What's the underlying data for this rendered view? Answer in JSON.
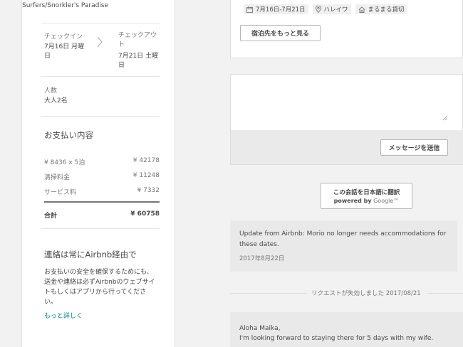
{
  "listing": {
    "name_line1": "Surfers/Snorkler's Paradise"
  },
  "booking": {
    "checkin_label": "チェックイン",
    "checkin_date_line1": "7月16日 月曜",
    "checkin_date_line2": "日",
    "checkout_label": "チェックアウ",
    "checkout_label2": "ト",
    "checkout_date_line1": "7月21日 土曜",
    "checkout_date_line2": "日",
    "guests_label": "人数",
    "guests_value": "大人2名"
  },
  "payment": {
    "title": "お支払い内容",
    "rows": [
      {
        "label": "¥ 8436 x 5泊",
        "amount": "¥ 42178"
      },
      {
        "label": "清掃料金",
        "amount": "¥ 11248"
      },
      {
        "label": "サービス料",
        "amount": "¥ 7332"
      }
    ],
    "total_label": "合計",
    "total_amount": "¥ 60758"
  },
  "notice": {
    "title": "連絡は常にAirbnb経由で",
    "line1": "お支払いの安全を確保するためにも、",
    "line2": "送金や連絡は必ずAirbnbのウェブサイ",
    "line3": "トもしくはアプリから行ってくださ",
    "line4": "い。",
    "more_link": "もっと詳しく"
  },
  "reservation": {
    "dates": "7月16日-7月21日",
    "location": "ハレイワ",
    "type": "まるまる貸切",
    "more_stays_button": "宿泊先をもっと見る"
  },
  "composer": {
    "send_button": "メッセージを送信"
  },
  "translate": {
    "button_label": "この会話を日本語に翻訳",
    "powered_by": "powered by",
    "google": "Google™"
  },
  "system_message": {
    "text": "Update from Airbnb: Morio no longer needs accommodations for these dates.",
    "date": "2017年8月22日"
  },
  "divider": {
    "text": "リクエストが失効しました 2017/08/21"
  },
  "guest_message": {
    "line1": "Aloha Maika,",
    "line2": "I'm looking forward to staying there for 5 days with my wife."
  },
  "colors": {
    "accent": "#008489",
    "text": "#484848",
    "muted": "#767676",
    "background": "#f2f2f2"
  }
}
